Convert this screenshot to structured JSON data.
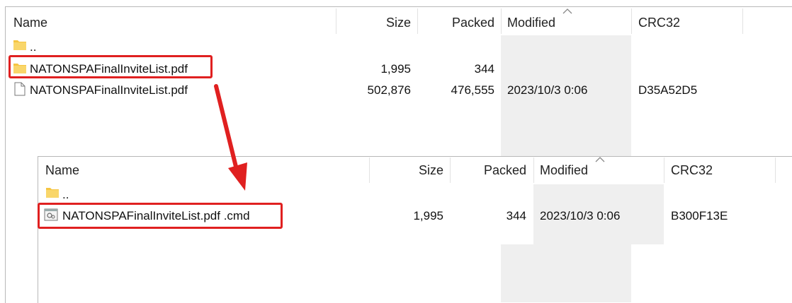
{
  "outer": {
    "headers": {
      "name": "Name",
      "size": "Size",
      "packed": "Packed",
      "modified": "Modified",
      "crc": "CRC32"
    },
    "rows": [
      {
        "icon": "folder-icon",
        "name": "..",
        "size": "",
        "packed": "",
        "modified": "",
        "crc": ""
      },
      {
        "icon": "folder-icon",
        "name": "NATONSPAFinalInviteList.pdf",
        "size": "1,995",
        "packed": "344",
        "modified": "",
        "crc": ""
      },
      {
        "icon": "document-icon",
        "name": "NATONSPAFinalInviteList.pdf",
        "size": "502,876",
        "packed": "476,555",
        "modified": "2023/10/3 0:06",
        "crc": "D35A52D5"
      }
    ]
  },
  "inner": {
    "headers": {
      "name": "Name",
      "size": "Size",
      "packed": "Packed",
      "modified": "Modified",
      "crc": "CRC32"
    },
    "rows": [
      {
        "icon": "folder-icon",
        "name": "..",
        "size": "",
        "packed": "",
        "modified": "",
        "crc": ""
      },
      {
        "icon": "cmd-script-icon",
        "name": "NATONSPAFinalInviteList.pdf .cmd",
        "size": "1,995",
        "packed": "344",
        "modified": "2023/10/3 0:06",
        "crc": "B300F13E"
      }
    ]
  },
  "colors": {
    "highlight": "#e02020",
    "folder": "#f5c542",
    "sorted_column": "#efefef"
  }
}
